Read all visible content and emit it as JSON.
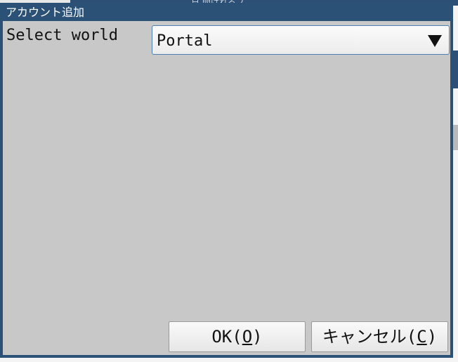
{
  "background_window": {
    "title": "日 間けれるブ"
  },
  "dialog": {
    "title": "アカウント追加",
    "world_label": "Select world",
    "world_select": {
      "selected": "Portal"
    },
    "ok_button": {
      "label": "OK(",
      "mnemonic": "O",
      "suffix": ")"
    },
    "cancel_button": {
      "label": "キャンセル(",
      "mnemonic": "C",
      "suffix": ")"
    }
  },
  "colors": {
    "title_bar": "#2b5177",
    "dialog_body": "#c8c8c8",
    "select_border": "#4c7fb3"
  },
  "icons": {
    "dropdown": "triangle-down-icon"
  }
}
